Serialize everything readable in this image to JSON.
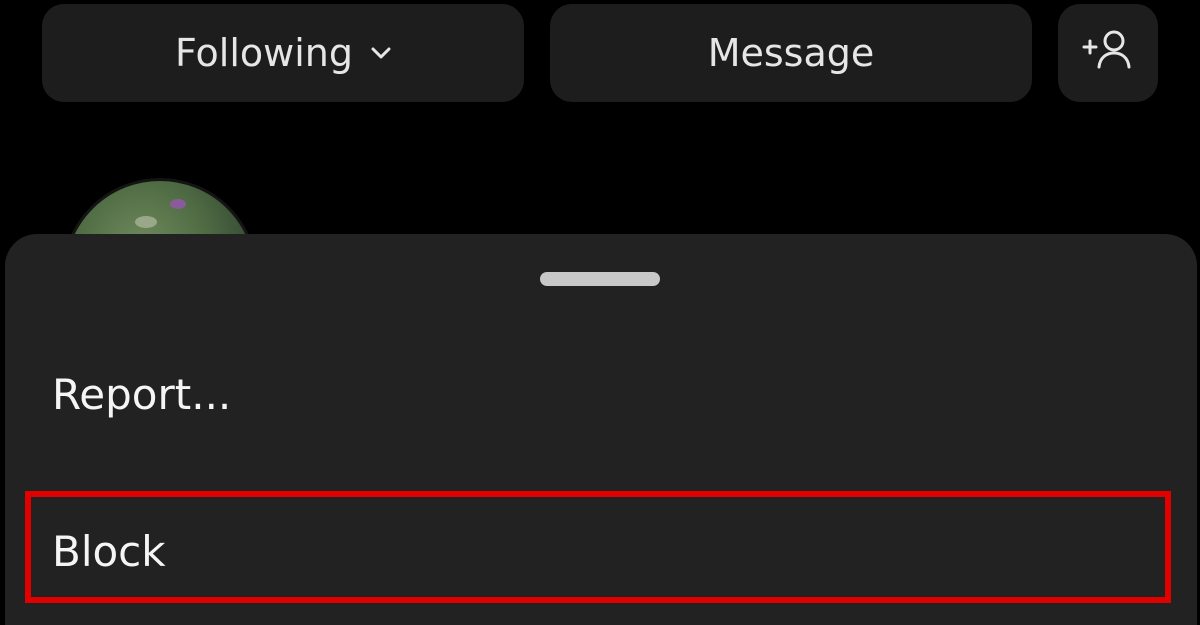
{
  "header_actions": {
    "following_label": "Following",
    "message_label": "Message",
    "add_person_icon": "add-person-icon"
  },
  "bottom_sheet": {
    "items": [
      {
        "label": "Report..."
      },
      {
        "label": "Block",
        "highlighted": true
      }
    ]
  },
  "colors": {
    "background": "#000000",
    "button": "#1d1d1d",
    "sheet": "#222222",
    "highlight": "#e00000"
  }
}
